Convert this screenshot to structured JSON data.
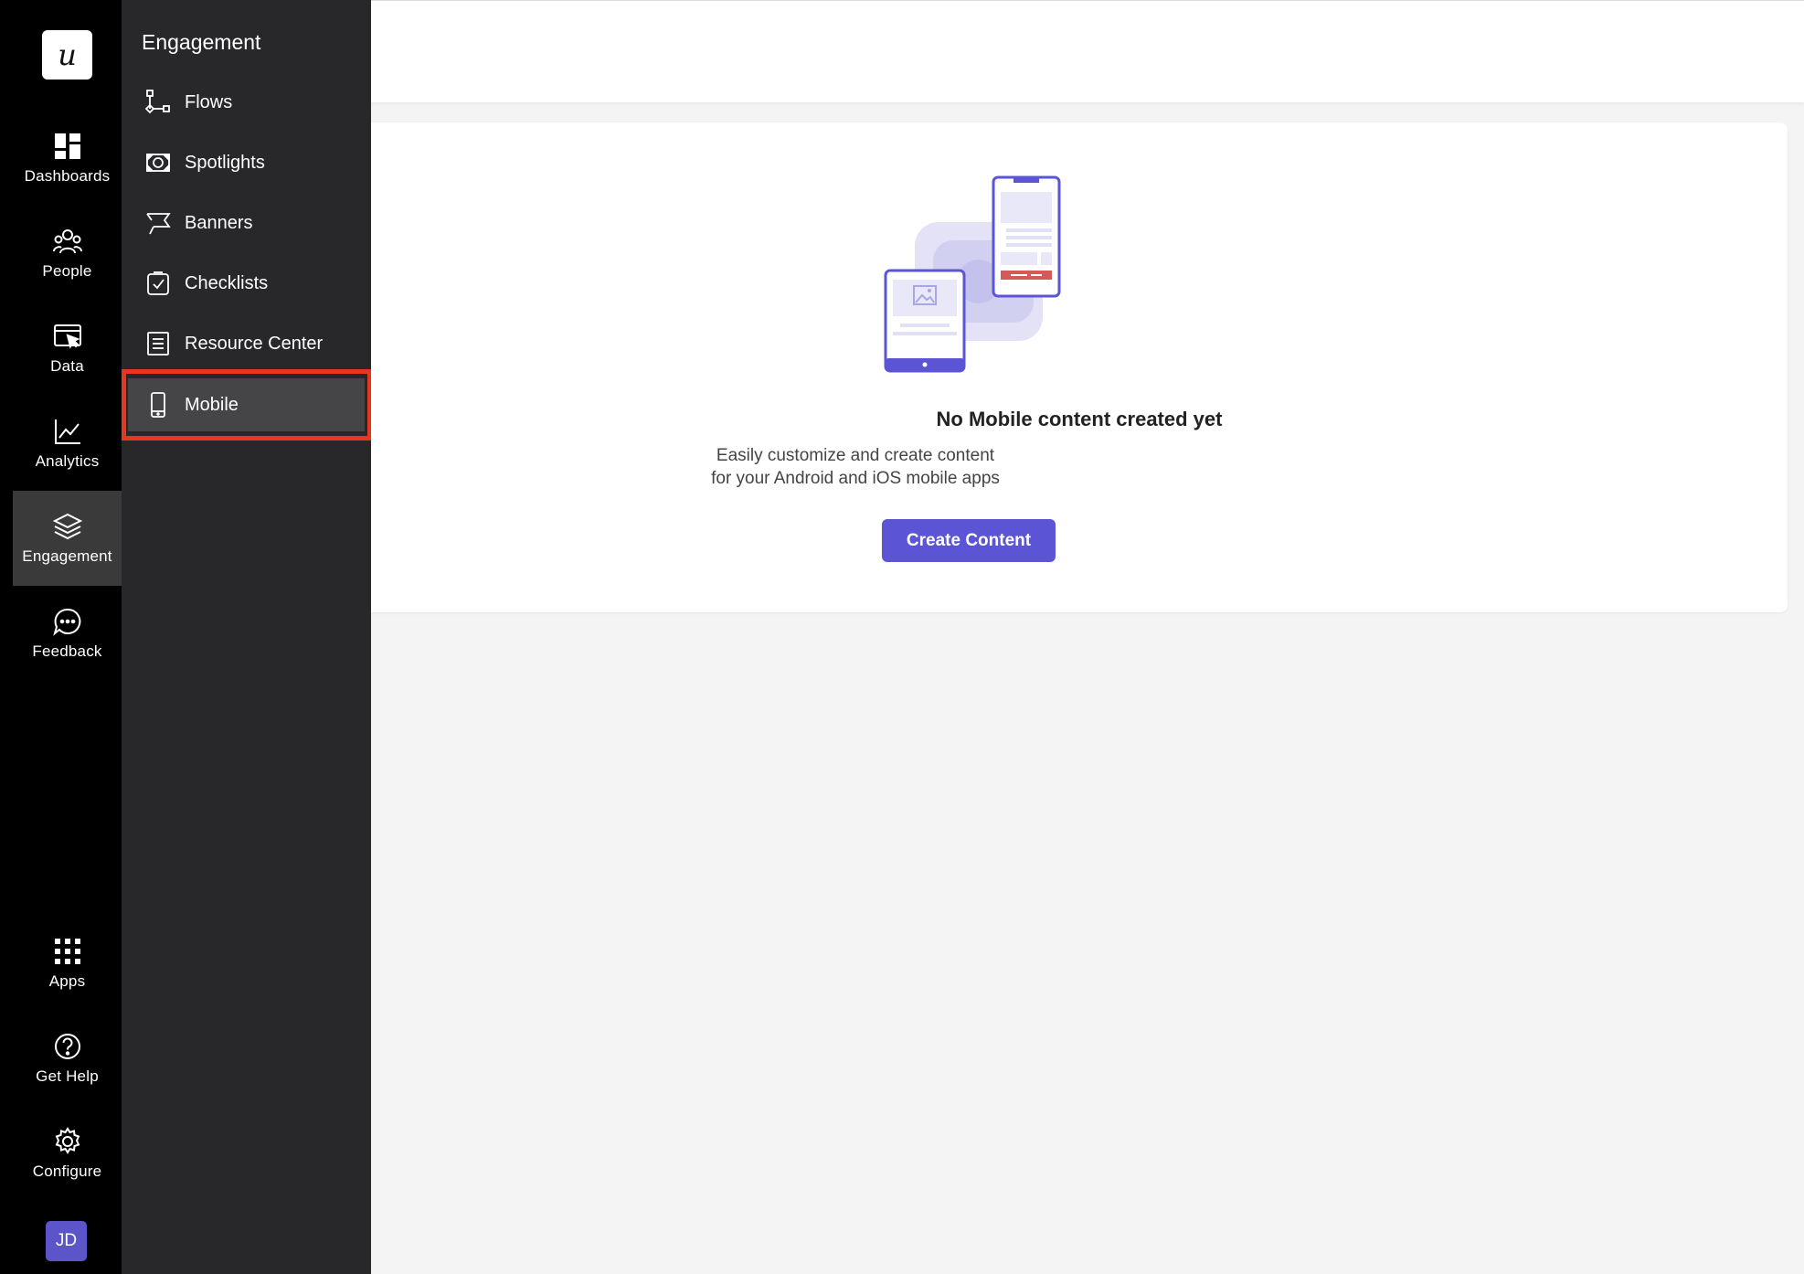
{
  "app": {
    "logo_letter": "u"
  },
  "rail": {
    "items": [
      {
        "label": "Dashboards",
        "icon": "dashboard-icon"
      },
      {
        "label": "People",
        "icon": "people-icon"
      },
      {
        "label": "Data",
        "icon": "data-icon"
      },
      {
        "label": "Analytics",
        "icon": "analytics-icon"
      },
      {
        "label": "Engagement",
        "icon": "layers-icon",
        "active": true
      },
      {
        "label": "Feedback",
        "icon": "chat-icon"
      },
      {
        "label": "Apps",
        "icon": "apps-grid-icon"
      },
      {
        "label": "Get Help",
        "icon": "help-icon"
      },
      {
        "label": "Configure",
        "icon": "gear-icon"
      }
    ],
    "avatar_initials": "JD"
  },
  "panel": {
    "title": "Engagement",
    "items": [
      {
        "label": "Flows",
        "icon": "flows-icon"
      },
      {
        "label": "Spotlights",
        "icon": "spotlight-icon"
      },
      {
        "label": "Banners",
        "icon": "banner-flag-icon"
      },
      {
        "label": "Checklists",
        "icon": "checklist-icon"
      },
      {
        "label": "Resource Center",
        "icon": "resource-center-icon"
      },
      {
        "label": "Mobile",
        "icon": "mobile-icon",
        "selected": true
      }
    ]
  },
  "empty_state": {
    "title": "No Mobile content created yet",
    "description": "Easily customize and create content for your Android and iOS mobile apps",
    "cta_label": "Create Content"
  },
  "colors": {
    "accent": "#5b55d6",
    "highlight_border": "#e8371f",
    "rail_bg": "#000000",
    "panel_bg": "#28282b"
  }
}
